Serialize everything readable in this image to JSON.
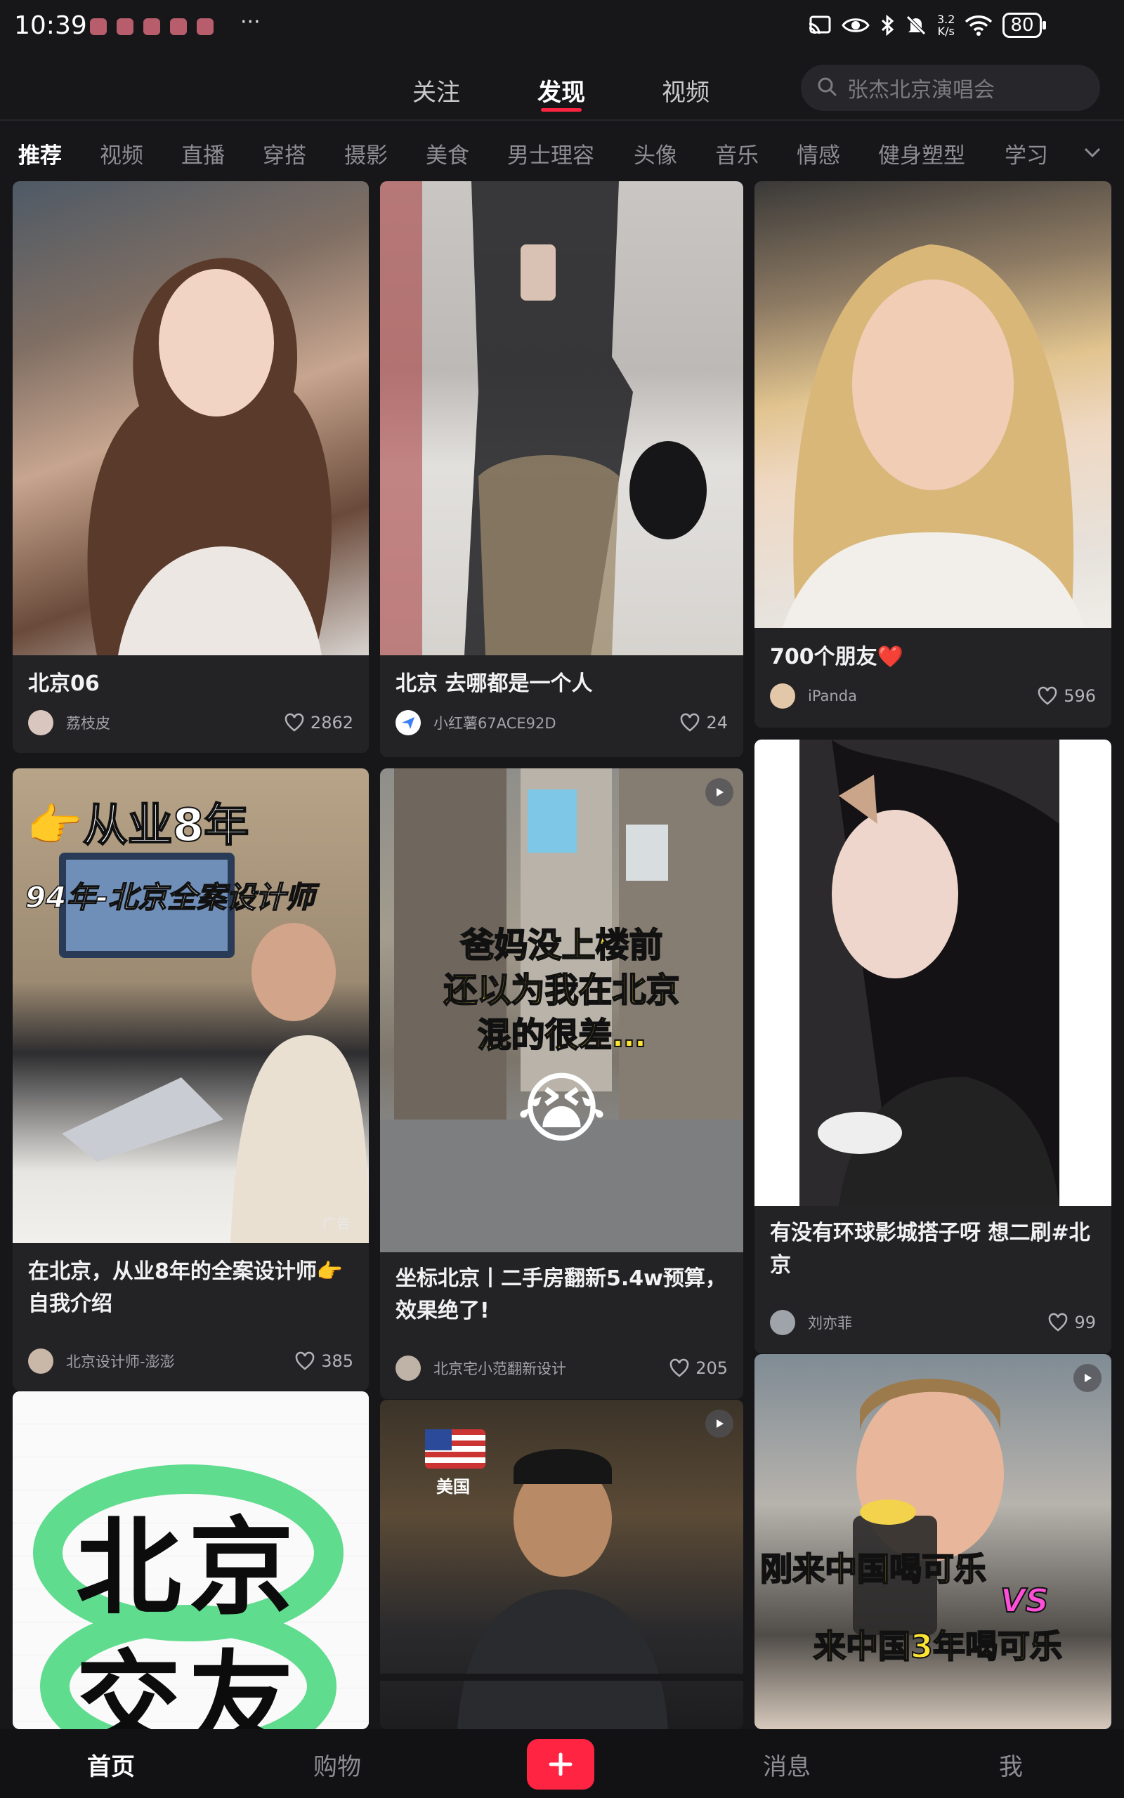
{
  "status_bar": {
    "time": "10:39",
    "more": "···",
    "speed_value": "3.2",
    "speed_unit": "K/s",
    "battery": "80"
  },
  "top_nav": {
    "tabs": [
      {
        "label": "关注"
      },
      {
        "label": "发现"
      },
      {
        "label": "视频"
      }
    ],
    "active_tab": "发现",
    "search_placeholder": "张杰北京演唱会"
  },
  "categories": [
    "推荐",
    "视频",
    "直播",
    "穿搭",
    "摄影",
    "美食",
    "男士理容",
    "头像",
    "音乐",
    "情感",
    "健身塑型",
    "学习"
  ],
  "feed": [
    {
      "title": "北京06",
      "author": "荔枝皮",
      "likes": "2862"
    },
    {
      "title": "北京 去哪都是一个人",
      "author": "小红薯67ACE92D",
      "likes": "24"
    },
    {
      "title": "700个朋友❤️",
      "author": "iPanda",
      "likes": "596"
    },
    {
      "title": "在北京，从业8年的全案设计师👉自我介绍",
      "author": "北京设计师-澎澎",
      "likes": "385",
      "ad_label": "广告",
      "overlay_line1": "从业8年",
      "overlay_line2": "94年-北京全案设计师"
    },
    {
      "title": "坐标北京丨二手房翻新5.4w预算，效果绝了!",
      "author": "北京宅小范翻新设计",
      "likes": "205",
      "overlay_lines": [
        "爸妈没上楼前",
        "还以为我在北京",
        "混的很差…"
      ]
    },
    {
      "title": "有没有环球影城搭子呀 想二刷#北京",
      "author": "刘亦菲",
      "likes": "99"
    },
    {
      "title": "",
      "overlay_lines": [
        "北京",
        "交友"
      ]
    },
    {
      "title": "",
      "overlay_country": "美国"
    },
    {
      "title": "",
      "overlay_line1": "刚来中国喝可乐",
      "overlay_vs": "VS",
      "overlay_line2": "来中国3年喝可乐"
    }
  ],
  "bottom_nav": {
    "home": "首页",
    "shop": "购物",
    "messages": "消息",
    "me": "我"
  },
  "colors": {
    "accent": "#ff2442",
    "background": "#17171a",
    "card": "#232326"
  }
}
